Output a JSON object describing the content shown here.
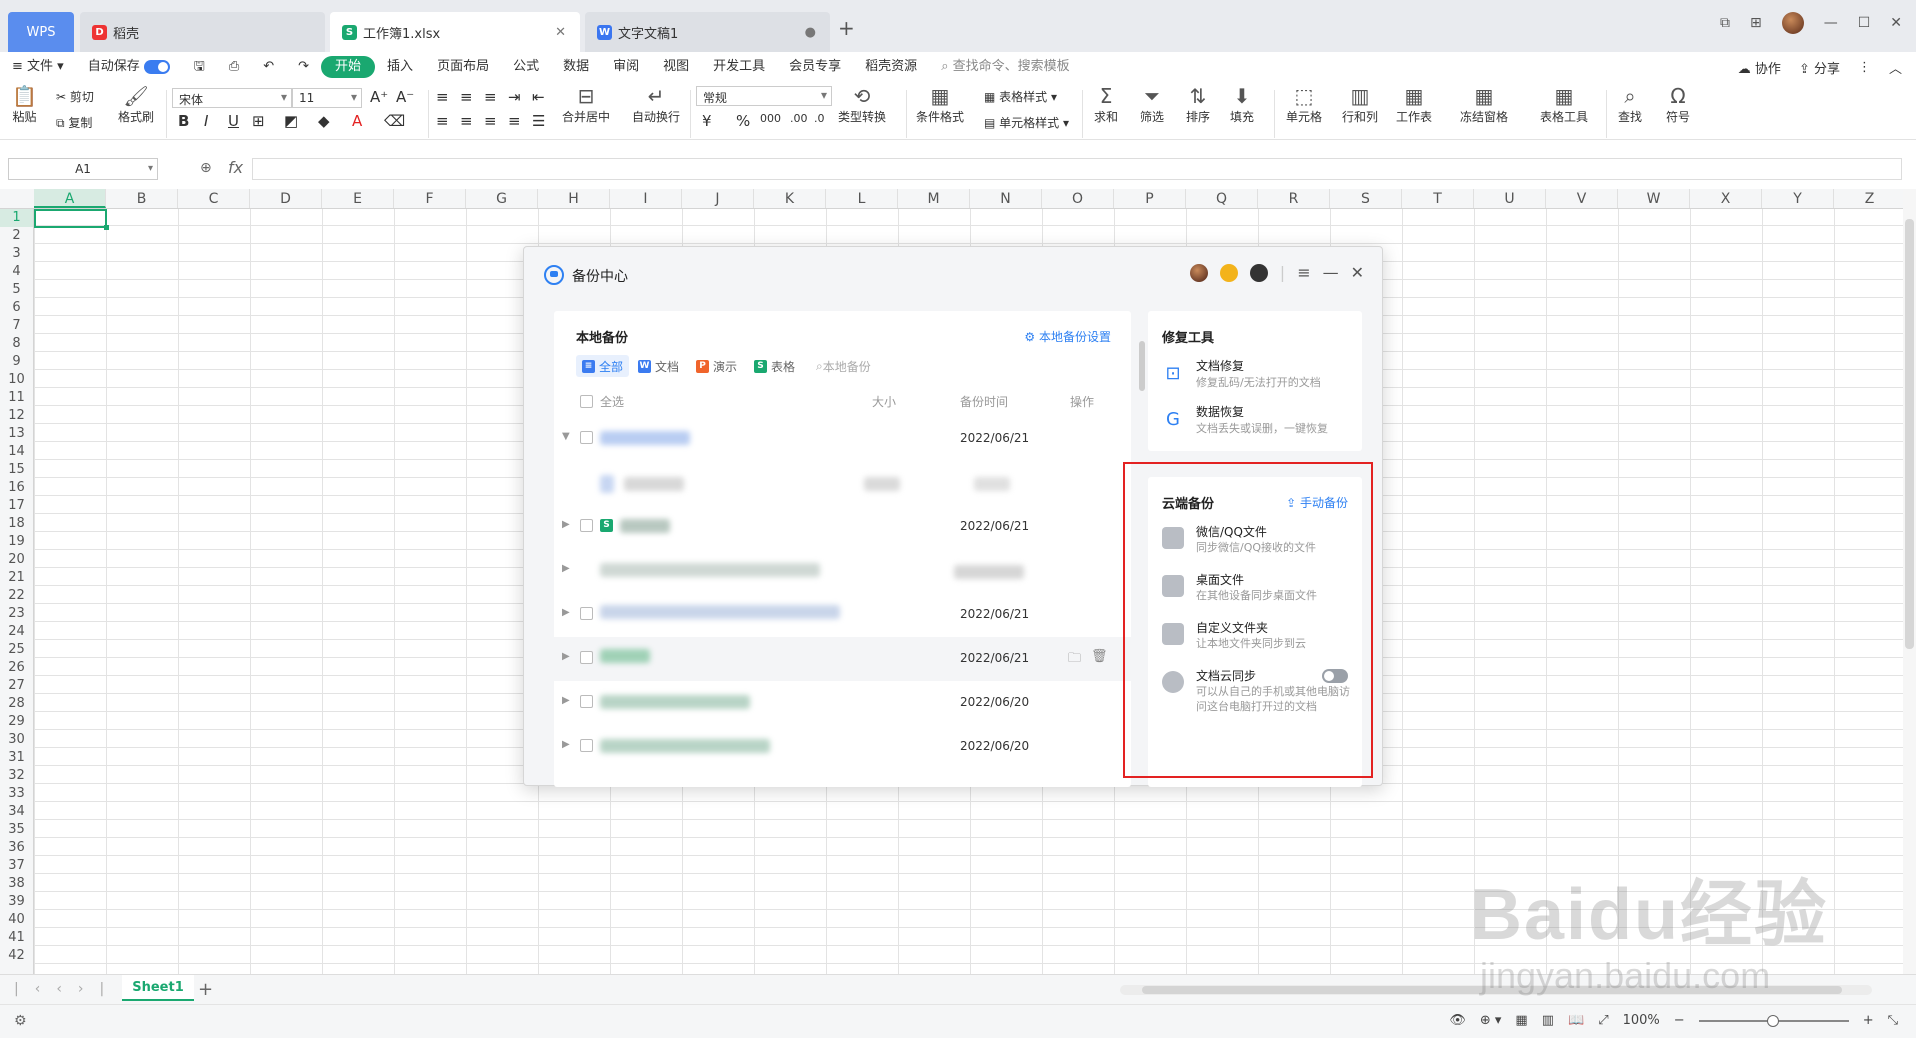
{
  "titlebar": {
    "tabs": [
      {
        "label": "WPS"
      },
      {
        "label": "稻壳"
      },
      {
        "label": "工作簿1.xlsx"
      },
      {
        "label": "文字文稿1"
      }
    ]
  },
  "menubar": {
    "file": "文件",
    "autosave": "自动保存",
    "items": [
      "开始",
      "插入",
      "页面布局",
      "公式",
      "数据",
      "审阅",
      "视图",
      "开发工具",
      "会员专享",
      "稻壳资源"
    ],
    "search": "查找命令、搜索模板",
    "collab": "协作",
    "share": "分享"
  },
  "ribbon": {
    "paste": "粘贴",
    "cut": "剪切",
    "copy": "复制",
    "format_painter": "格式刷",
    "font": "宋体",
    "font_size": "11",
    "merge": "合并居中",
    "wrap": "自动换行",
    "number_format": "常规",
    "type_convert": "类型转换",
    "cond_format": "条件格式",
    "table_style": "表格样式",
    "cell_style": "单元格样式",
    "sum": "求和",
    "filter": "筛选",
    "sort": "排序",
    "fill": "填充",
    "cell": "单元格",
    "row_col": "行和列",
    "worksheet": "工作表",
    "freeze": "冻结窗格",
    "table_tools": "表格工具",
    "find": "查找",
    "symbol": "符号"
  },
  "formula": {
    "cell_ref": "A1",
    "fx": "fx"
  },
  "columns": [
    "A",
    "B",
    "C",
    "D",
    "E",
    "F",
    "G",
    "H",
    "I",
    "J",
    "K",
    "L",
    "M",
    "N",
    "O",
    "P",
    "Q",
    "R",
    "S",
    "T",
    "U",
    "V",
    "W",
    "X",
    "Y",
    "Z"
  ],
  "rows": [
    "1",
    "2",
    "3",
    "4",
    "5",
    "6",
    "7",
    "8",
    "9",
    "10",
    "11",
    "12",
    "13",
    "14",
    "15",
    "16",
    "17",
    "18",
    "19",
    "20",
    "21",
    "22",
    "23",
    "24",
    "25",
    "26",
    "27",
    "28",
    "29",
    "30",
    "31",
    "32",
    "33",
    "34",
    "35",
    "36",
    "37",
    "38",
    "39",
    "40",
    "41",
    "42"
  ],
  "sheet": {
    "name": "Sheet1"
  },
  "status": {
    "zoom": "100%"
  },
  "dialog": {
    "title": "备份中心",
    "local": {
      "title": "本地备份",
      "settings": "本地备份设置",
      "filters": [
        "全部",
        "文档",
        "演示",
        "表格",
        "本地备份"
      ],
      "headers": {
        "select_all": "全选",
        "size": "大小",
        "time": "备份时间",
        "ops": "操作"
      },
      "rows": [
        {
          "date": "2022/06/21"
        },
        {
          "date": ""
        },
        {
          "date": "2022/06/21"
        },
        {
          "date": ""
        },
        {
          "date": "2022/06/21"
        },
        {
          "date": "2022/06/21"
        },
        {
          "date": "2022/06/20"
        },
        {
          "date": "2022/06/20"
        }
      ]
    },
    "repair": {
      "title": "修复工具",
      "items": [
        {
          "title": "文档修复",
          "desc": "修复乱码/无法打开的文档"
        },
        {
          "title": "数据恢复",
          "desc": "文档丢失或误删，一键恢复"
        }
      ]
    },
    "cloud": {
      "title": "云端备份",
      "manual": "手动备份",
      "items": [
        {
          "title": "微信/QQ文件",
          "desc": "同步微信/QQ接收的文件"
        },
        {
          "title": "桌面文件",
          "desc": "在其他设备同步桌面文件"
        },
        {
          "title": "自定义文件夹",
          "desc": "让本地文件夹同步到云"
        },
        {
          "title": "文档云同步",
          "desc": "可以从自己的手机或其他电脑访问这台电脑打开过的文档"
        }
      ]
    }
  },
  "watermark": {
    "line1": "Baidu经验",
    "line2": "jingyan.baidu.com"
  }
}
